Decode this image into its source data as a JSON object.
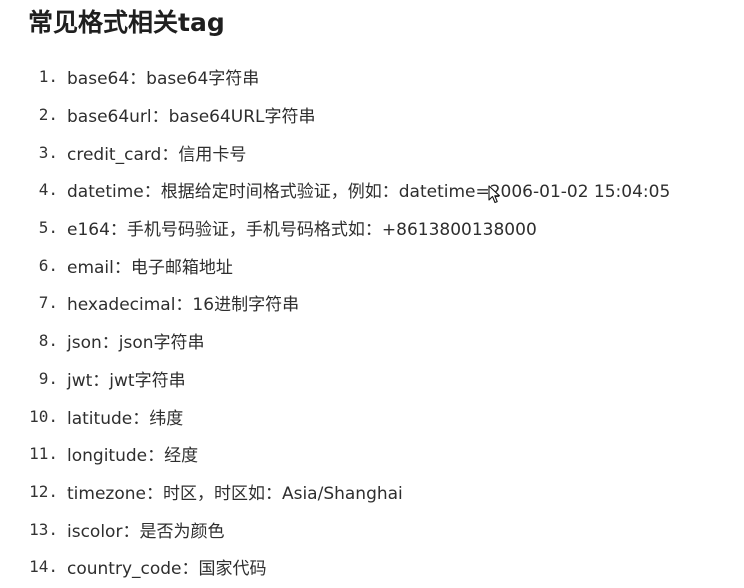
{
  "heading": "常见格式相关tag",
  "items": [
    {
      "num": "1.",
      "text": "base64：base64字符串"
    },
    {
      "num": "2.",
      "text": "base64url：base64URL字符串"
    },
    {
      "num": "3.",
      "text": "credit_card：信用卡号"
    },
    {
      "num": "4.",
      "text": "datetime：根据给定时间格式验证，例如：datetime=2006-01-02 15:04:05"
    },
    {
      "num": "5.",
      "text": "e164：手机号码验证，手机号码格式如：+8613800138000"
    },
    {
      "num": "6.",
      "text": "email：电子邮箱地址"
    },
    {
      "num": "7.",
      "text": "hexadecimal：16进制字符串"
    },
    {
      "num": "8.",
      "text": "json：json字符串"
    },
    {
      "num": "9.",
      "text": "jwt：jwt字符串"
    },
    {
      "num": "10.",
      "text": "latitude：纬度"
    },
    {
      "num": "11.",
      "text": "longitude：经度"
    },
    {
      "num": "12.",
      "text": "timezone：时区，时区如：Asia/Shanghai"
    },
    {
      "num": "13.",
      "text": "iscolor：是否为颜色"
    },
    {
      "num": "14.",
      "text": "country_code：国家代码"
    }
  ],
  "cursor_icon": "mouse-pointer-icon"
}
